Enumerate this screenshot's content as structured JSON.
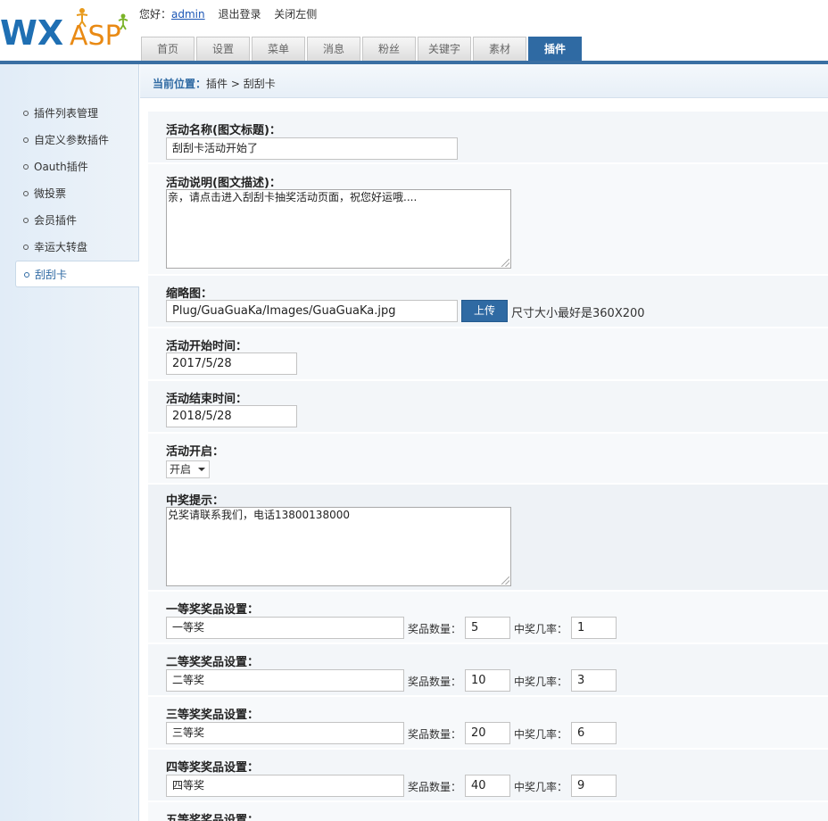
{
  "header": {
    "logo": {
      "wx": "WX",
      "asp": "ASP"
    },
    "greeting": "您好：",
    "username": "admin",
    "logout": "退出登录",
    "close_left": "关闭左侧"
  },
  "nav": {
    "tabs": [
      "首页",
      "设置",
      "菜单",
      "消息",
      "粉丝",
      "关键字",
      "素材",
      "插件"
    ],
    "active_index": 7
  },
  "sidebar": {
    "items": [
      "插件列表管理",
      "自定义参数插件",
      "Oauth插件",
      "微投票",
      "会员插件",
      "幸运大转盘",
      "刮刮卡"
    ],
    "active_index": 6
  },
  "breadcrumb": {
    "label": "当前位置：",
    "path": "插件 > 刮刮卡"
  },
  "form": {
    "name_label": "活动名称(图文标题)：",
    "name_value": "刮刮卡活动开始了",
    "desc_label": "活动说明(图文描述)：",
    "desc_value": "亲，请点击进入刮刮卡抽奖活动页面，祝您好运哦....",
    "thumb_label": "缩略图：",
    "thumb_value": "Plug/GuaGuaKa/Images/GuaGuaKa.jpg",
    "upload_button": "上传",
    "thumb_hint": "尺寸大小最好是360X200",
    "start_label": "活动开始时间：",
    "start_value": "2017/5/28",
    "end_label": "活动结束时间：",
    "end_value": "2018/5/28",
    "open_label": "活动开启：",
    "open_value": "开启",
    "tip_label": "中奖提示：",
    "tip_value": "兑奖请联系我们，电话13800138000",
    "qty_label": "奖品数量：",
    "rate_label": "中奖几率：",
    "prizes": [
      {
        "label": "一等奖奖品设置：",
        "name": "一等奖",
        "qty": "5",
        "rate": "1"
      },
      {
        "label": "二等奖奖品设置：",
        "name": "二等奖",
        "qty": "10",
        "rate": "3"
      },
      {
        "label": "三等奖奖品设置：",
        "name": "三等奖",
        "qty": "20",
        "rate": "6"
      },
      {
        "label": "四等奖奖品设置：",
        "name": "四等奖",
        "qty": "40",
        "rate": "9"
      },
      {
        "label": "五等奖奖品设置："
      }
    ]
  }
}
